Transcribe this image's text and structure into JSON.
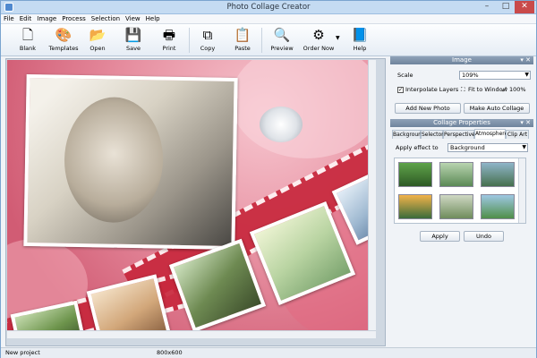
{
  "window": {
    "title": "Photo Collage Creator",
    "minimize": "–",
    "maximize": "□",
    "close": "✕"
  },
  "menu": [
    "File",
    "Edit",
    "Image",
    "Process",
    "Selection",
    "View",
    "Help"
  ],
  "toolbar": [
    {
      "label": "Blank",
      "icon": "blank-page-icon",
      "glyph": "🗋"
    },
    {
      "label": "Templates",
      "icon": "palette-icon",
      "glyph": "🎨"
    },
    {
      "label": "Open",
      "icon": "open-folder-icon",
      "glyph": "📂"
    },
    {
      "label": "Save",
      "icon": "floppy-disk-icon",
      "glyph": "💾"
    },
    {
      "label": "Print",
      "icon": "printer-icon",
      "glyph": "🖶"
    },
    {
      "label": "Copy",
      "icon": "copy-icon",
      "glyph": "⧉"
    },
    {
      "label": "Paste",
      "icon": "paste-icon",
      "glyph": "📋"
    },
    {
      "label": "Preview",
      "icon": "magnifier-icon",
      "glyph": "🔍"
    },
    {
      "label": "Order Now",
      "icon": "gear-icon",
      "glyph": "⚙"
    },
    {
      "label": "Help",
      "icon": "help-book-icon",
      "glyph": "📘"
    }
  ],
  "panel": {
    "image_header": "Image",
    "scale_label": "Scale",
    "scale_value": "109%",
    "interpolate_label": "Interpolate Layers",
    "interpolate_checked": true,
    "fit_label": "Fit to Window",
    "zoom100_label": "100%",
    "add_photo": "Add New Photo",
    "auto_collage": "Make Auto Collage",
    "props_header": "Collage Properties",
    "tabs": [
      "Background",
      "Selector",
      "Perspective",
      "Atmosphere",
      "Clip Art"
    ],
    "active_tab": "Atmosphere",
    "apply_effect_label": "Apply effect to",
    "apply_effect_value": "Background",
    "apply": "Apply",
    "undo": "Undo"
  },
  "status": {
    "project": "New project",
    "size": "800x600"
  },
  "colors": {
    "accent": "#6f849c",
    "canvas": "#e58b9d",
    "strip": "#c8283d"
  }
}
